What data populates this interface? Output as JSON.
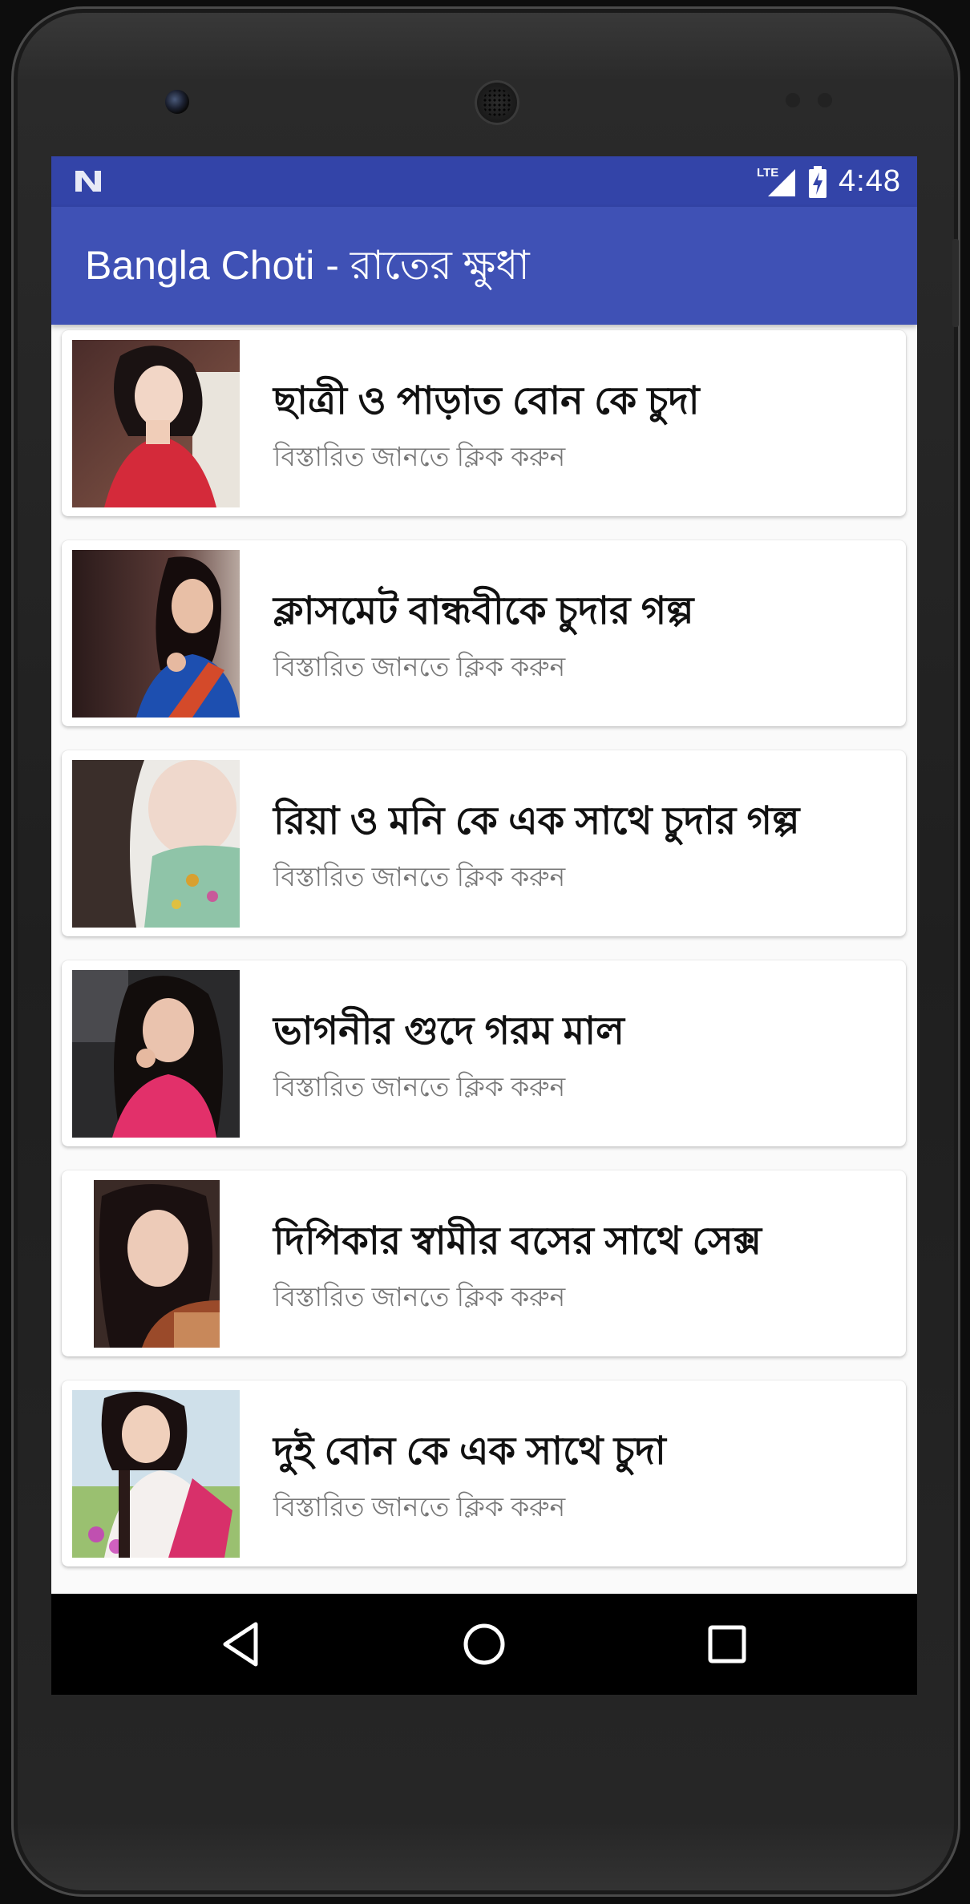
{
  "status_bar": {
    "network": "LTE",
    "time": "4:48"
  },
  "app_bar": {
    "title": "Bangla Choti - রাতের ক্ষুধা"
  },
  "stories": [
    {
      "title": "ছাত্রী ও পাড়াত বোন কে চুদা",
      "subtitle": "বিস্তারিত জানতে ক্লিক করুন"
    },
    {
      "title": "ক্লাসমেট বান্ধবীকে চুদার গল্প",
      "subtitle": "বিস্তারিত জানতে ক্লিক করুন"
    },
    {
      "title": "রিয়া ও মনি কে এক সাথে চুদার গল্প",
      "subtitle": "বিস্তারিত জানতে ক্লিক করুন"
    },
    {
      "title": "ভাগনীর গুদে গরম মাল",
      "subtitle": "বিস্তারিত জানতে ক্লিক করুন"
    },
    {
      "title": "দিপিকার স্বামীর বসের সাথে সেক্স",
      "subtitle": "বিস্তারিত জানতে ক্লিক করুন"
    },
    {
      "title": "দুই বোন কে এক সাথে চুদা",
      "subtitle": "বিস্তারিত জানতে ক্লিক করুন"
    }
  ],
  "nav_bar": {
    "back_icon": "back-triangle-icon",
    "home_icon": "home-circle-icon",
    "recents_icon": "recents-square-icon"
  },
  "colors": {
    "status_bar": "#3344a8",
    "app_bar": "#3f51b5",
    "background": "#fafafa"
  }
}
